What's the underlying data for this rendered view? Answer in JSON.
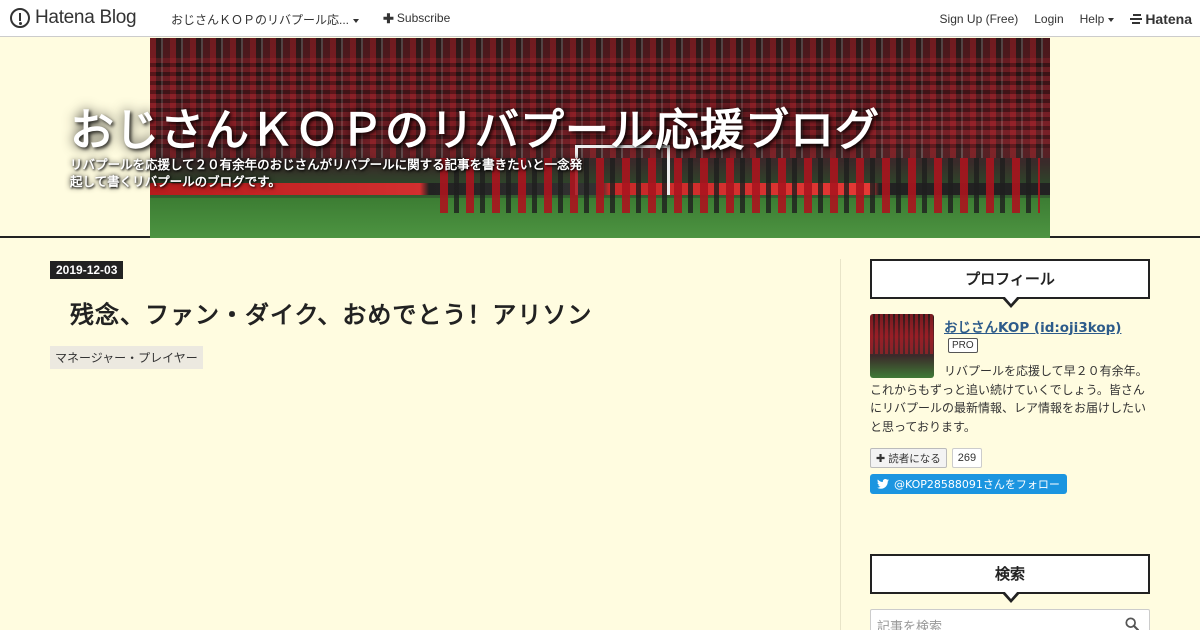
{
  "globalheader": {
    "logo_text": "Hatena Blog",
    "blog_name": "おじさんＫＯＰのリバプール応...",
    "subscribe_label": "Subscribe",
    "signup_label": "Sign Up (Free)",
    "login_label": "Login",
    "help_label": "Help",
    "hatena_label": "Hatena"
  },
  "blog": {
    "title": "おじさんＫＯＰのリバプール応援ブログ",
    "description": "リバプールを応援して２０有余年のおじさんがリバプールに関する記事を書きたいと一念発起して書くリバプールのブログです。"
  },
  "entry": {
    "date": "2019-12-03",
    "title": "残念、ファン・ダイク、おめでとう！アリソン",
    "category": "マネージャー・プレイヤー"
  },
  "sidebar": {
    "profile": {
      "module_title": "プロフィール",
      "name": "おじさんKOP (id:oji3kop)",
      "badge": "PRO",
      "description": "リバプールを応援して早２０有余年。これからもずっと追い続けていくでしょう。皆さんにリバプールの最新情報、レア情報をお届けしたいと思っております。",
      "reader_button_label": "読者になる",
      "reader_count": "269",
      "twitter_label": "@KOP28588091さんをフォロー"
    },
    "search": {
      "module_title": "検索",
      "placeholder": "記事を検索"
    }
  }
}
